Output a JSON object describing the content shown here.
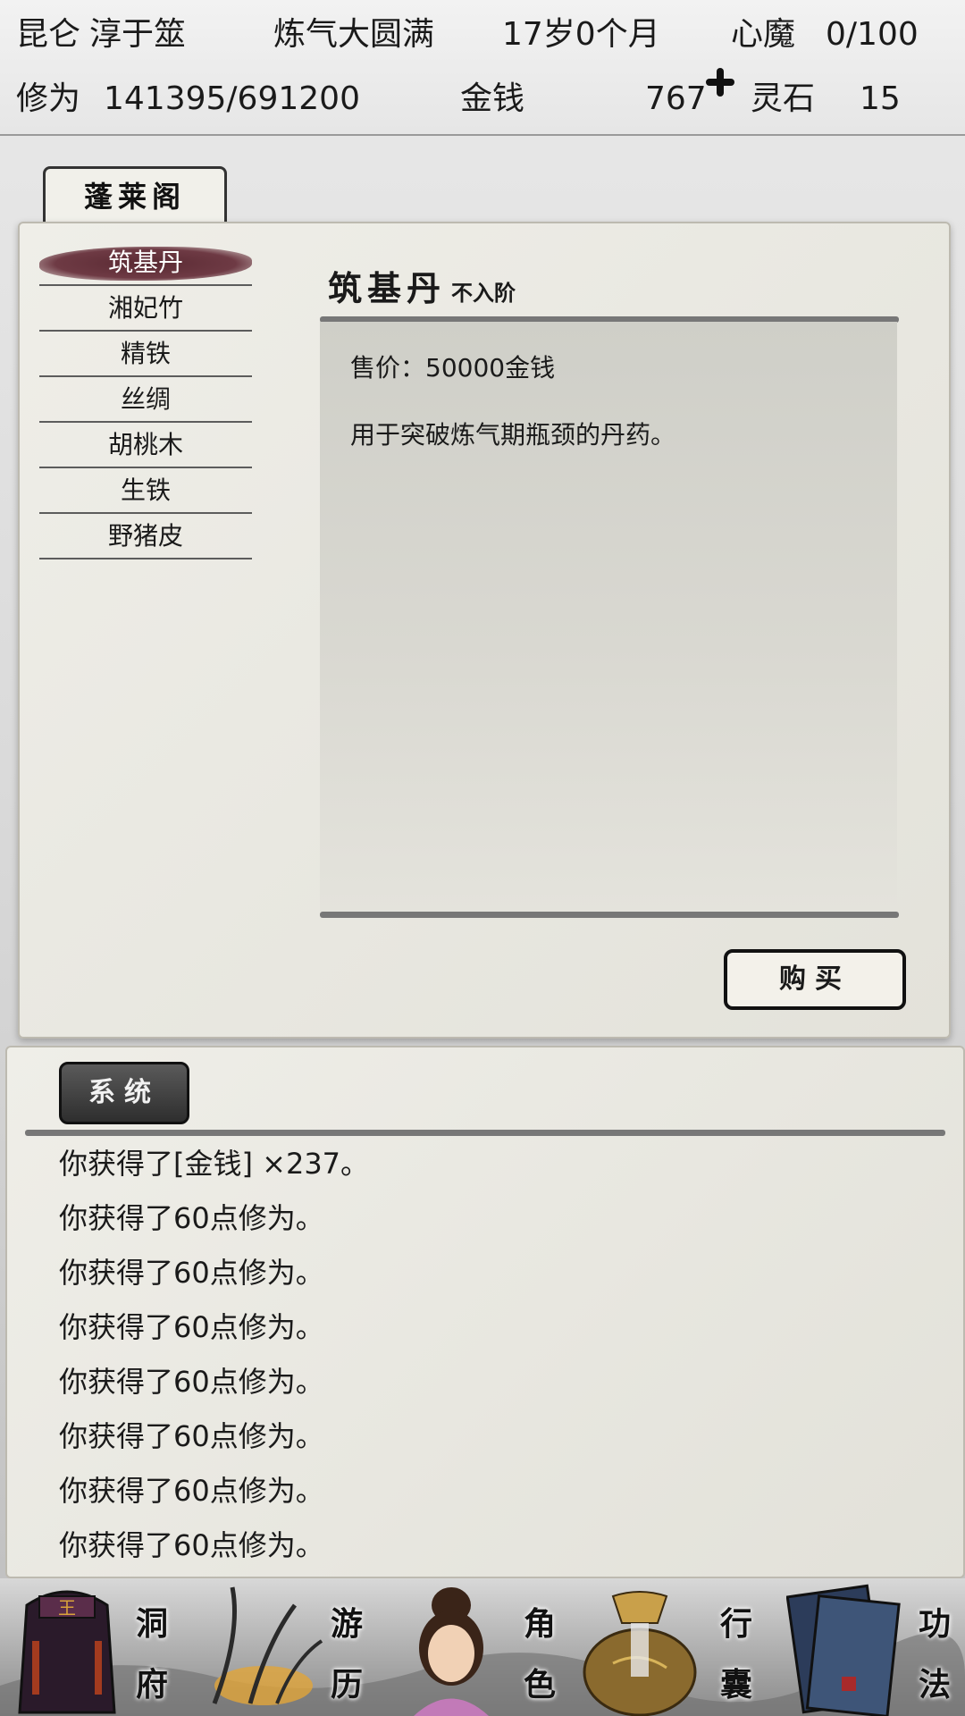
{
  "header": {
    "sect": "昆仑",
    "name": "淳于筮",
    "realm": "炼气大圆满",
    "age": "17岁0个月",
    "inner_demon_label": "心魔",
    "inner_demon_value": "0/100",
    "cultivation_label": "修为",
    "cultivation_value": "141395/691200",
    "money_label": "金钱",
    "money_value": "767",
    "spirit_stone_label": "灵石",
    "spirit_stone_value": "15"
  },
  "shop": {
    "tab_label": "蓬莱阁",
    "items": [
      "筑基丹",
      "湘妃竹",
      "精铁",
      "丝绸",
      "胡桃木",
      "生铁",
      "野猪皮"
    ],
    "selected_index": 0,
    "detail": {
      "name": "筑基丹",
      "grade": "不入阶",
      "price": "售价：50000金钱",
      "description": "用于突破炼气期瓶颈的丹药。"
    },
    "buy_label": "购买"
  },
  "log": {
    "tab_label": "系统",
    "lines": [
      "你获得了[金钱] ×237。",
      "你获得了60点修为。",
      "你获得了60点修为。",
      "你获得了60点修为。",
      "你获得了60点修为。",
      "你获得了60点修为。",
      "你获得了60点修为。",
      "你获得了60点修为。"
    ]
  },
  "nav": [
    {
      "label_top": "洞",
      "label_bottom": "府",
      "icon": "cave-bag-icon"
    },
    {
      "label_top": "游",
      "label_bottom": "历",
      "icon": "travel-grass-icon"
    },
    {
      "label_top": "角",
      "label_bottom": "色",
      "icon": "character-portrait-icon"
    },
    {
      "label_top": "行",
      "label_bottom": "囊",
      "icon": "inventory-sack-icon"
    },
    {
      "label_top": "功",
      "label_bottom": "法",
      "icon": "technique-books-icon"
    }
  ]
}
